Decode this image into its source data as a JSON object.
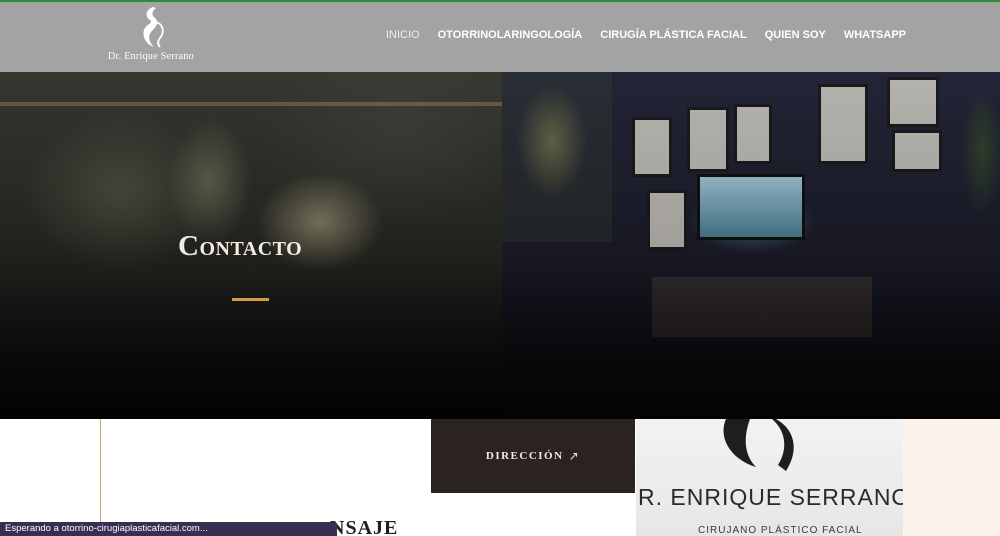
{
  "header": {
    "logo_text": "Dr. Enrique Serrano",
    "nav": [
      "INICIO",
      "OTORRINOLARINGOLOGÍA",
      "CIRUGÍA PLÁSTICA FACIAL",
      "QUIEN SOY",
      "WHATSAPP"
    ],
    "active_nav": "INICIO"
  },
  "hero": {
    "title": "Contacto"
  },
  "content": {
    "direction_button": "DIRECCIÓN",
    "direction_icon": "arrow-up-right-icon",
    "sign_brand": "R. ENRIQUE SERRANO",
    "sign_subtitle": "CIRUJANO PLÁSTICO FACIAL",
    "section_heading": "NSAJE"
  },
  "status_bar": {
    "text": "Esperando a otorrino-cirugiaplasticafacial.com..."
  },
  "colors": {
    "header_bg": "#a3a3a3",
    "accent": "#d79b45",
    "button_bg": "#2a2320",
    "top_accent": "#2e8b3e",
    "status_bg": "#3a2d52"
  }
}
